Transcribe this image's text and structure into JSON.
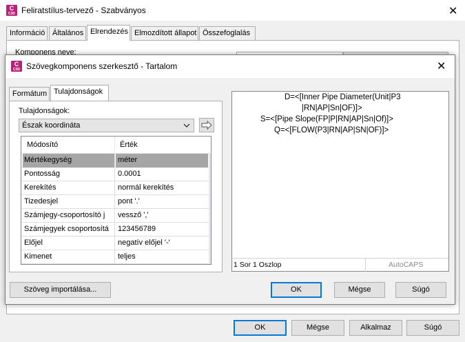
{
  "outer": {
    "icon_label": "C",
    "icon_sublabel": "C3D",
    "title": "Feliratstílus-tervező - Szabványos",
    "close_glyph": "✕",
    "tabs": [
      {
        "label": "Információ"
      },
      {
        "label": "Általános"
      },
      {
        "label": "Elrendezés",
        "active": true
      },
      {
        "label": "Elmozdított állapot"
      },
      {
        "label": "Összefoglalás"
      }
    ],
    "component_name_label": "Komponens neve:",
    "buttons": {
      "ok": "OK",
      "cancel": "Mégse",
      "apply": "Alkalmaz",
      "help": "Súgó"
    }
  },
  "inner": {
    "icon_label": "C",
    "icon_sublabel": "C3D",
    "title": "Szövegkomponens szerkesztő - Tartalom",
    "close_glyph": "✕",
    "tabs": [
      {
        "label": "Formátum"
      },
      {
        "label": "Tulajdonságok",
        "active": true
      }
    ],
    "properties_label": "Tulajdonságok:",
    "properties_selected": "Észak koordináta",
    "insert_arrow_icon": "arrow-right-icon",
    "grid": {
      "headers": [
        "Módosító",
        "Érték"
      ],
      "rows": [
        {
          "modifier": "Mértékegység",
          "value": "méter",
          "selected": true
        },
        {
          "modifier": "Pontosság",
          "value": "0.0001"
        },
        {
          "modifier": "Kerekítés",
          "value": "normál kerekítés"
        },
        {
          "modifier": "Tizedesjel",
          "value": "pont  '.'"
        },
        {
          "modifier": "Számjegy-csoportosító j",
          "value": "vessző ','"
        },
        {
          "modifier": "Számjegyek csoportosítá",
          "value": "123456789"
        },
        {
          "modifier": "Előjel",
          "value": "negatív előjel '-'"
        },
        {
          "modifier": "Kimenet",
          "value": "teljes"
        }
      ]
    },
    "editor_lines": [
      "D=<[Inner Pipe Diameter(Unit|P3",
      "|RN|AP|Sn|OF)]>",
      "S=<[Pipe Slope(FP|P|RN|AP|Sn|Of)]>",
      "Q=<[FLOW(P3|RN|AP|SN|OF)]>"
    ],
    "status_position": "1 Sor 1 Oszlop",
    "status_autocaps": "AutoCAPS",
    "import_button": "Szöveg importálása...",
    "buttons": {
      "ok": "OK",
      "cancel": "Mégse",
      "help": "Súgó"
    }
  }
}
